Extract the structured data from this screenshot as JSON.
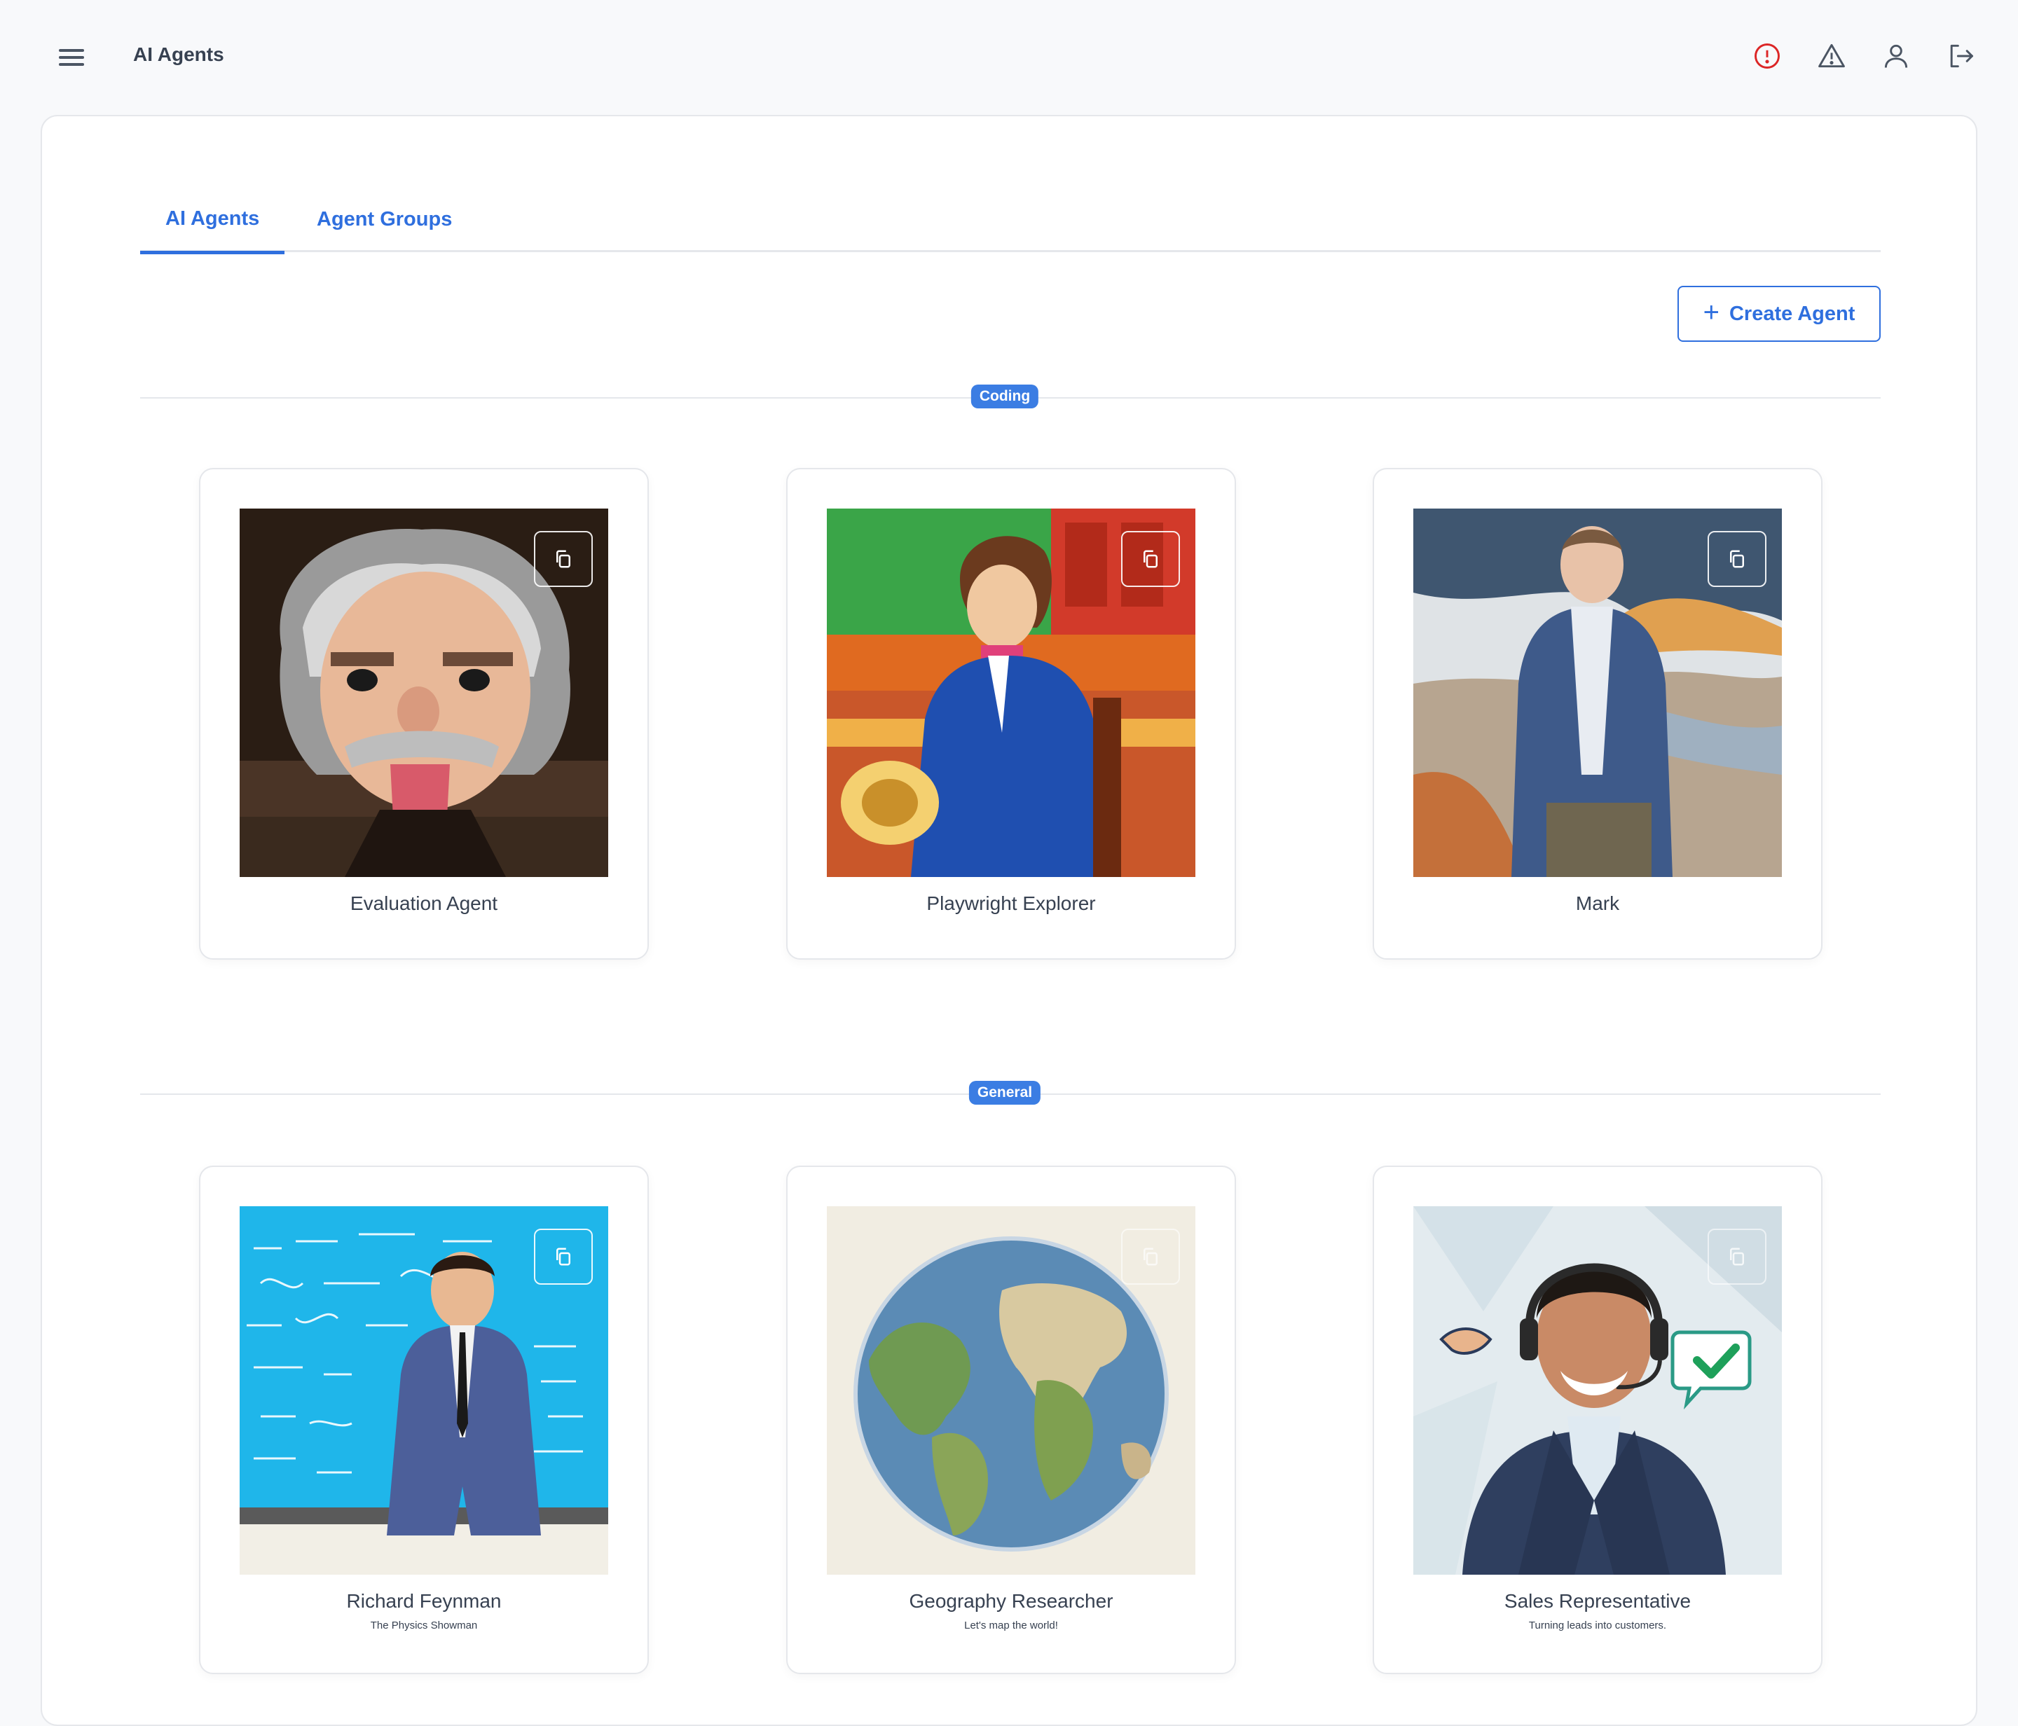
{
  "header": {
    "title": "AI Agents"
  },
  "tabs": [
    {
      "label": "AI Agents",
      "active": true
    },
    {
      "label": "Agent Groups",
      "active": false
    }
  ],
  "actions": {
    "create_label": "Create Agent"
  },
  "categories": [
    {
      "name": "Coding",
      "agents": [
        {
          "name": "Evaluation Agent",
          "subtitle": ""
        },
        {
          "name": "Playwright Explorer",
          "subtitle": ""
        },
        {
          "name": "Mark",
          "subtitle": ""
        }
      ]
    },
    {
      "name": "General",
      "agents": [
        {
          "name": "Richard Feynman",
          "subtitle": "The Physics Showman"
        },
        {
          "name": "Geography Researcher",
          "subtitle": "Let's map the world!"
        },
        {
          "name": "Sales Representative",
          "subtitle": "Turning leads into customers."
        }
      ]
    }
  ],
  "colors": {
    "accent": "#2f6fde",
    "badge": "#3b7de3",
    "alert": "#dc2626"
  }
}
